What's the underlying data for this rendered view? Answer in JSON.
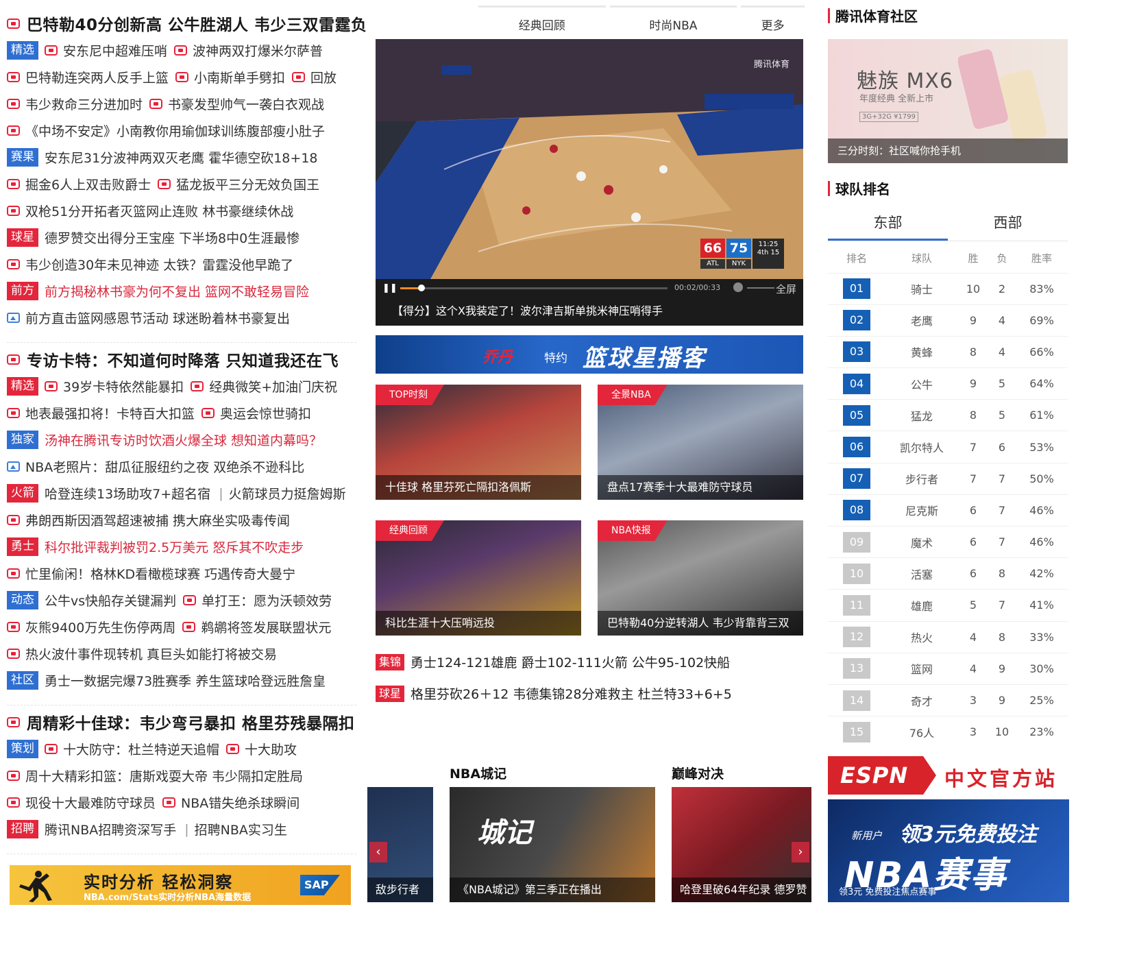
{
  "colors": {
    "accent_red": "#e3263b",
    "accent_blue": "#2f6fd1",
    "rank_top": "#1560b5",
    "rank_low": "#c9c9c9"
  },
  "left": {
    "sections": [
      {
        "title": "巴特勒40分创新高 公牛胜湖人 韦少三双雷霆负",
        "rows": [
          {
            "tag": "精选",
            "tag_color": "blue",
            "items": [
              "安东尼中超难压哨",
              "波神两双打爆米尔萨普"
            ]
          },
          {
            "items": [
              "巴特勒连突两人反手上篮",
              "小南斯单手劈扣",
              "回放"
            ]
          },
          {
            "items": [
              "韦少救命三分进加时",
              "书豪发型帅气一袭白衣观战"
            ]
          },
          {
            "items": [
              "《中场不安定》小南教你用瑜伽球训练腹部瘦小肚子"
            ]
          },
          {
            "tag": "赛果",
            "tag_color": "blue",
            "text": "安东尼31分波神两双灭老鹰 霍华德空砍18+18"
          },
          {
            "items": [
              "掘金6人上双击败爵士",
              "猛龙扳平三分无效负国王"
            ]
          },
          {
            "items": [
              "双枪51分开拓者灭篮网止连败 林书豪继续休战"
            ]
          },
          {
            "tag": "球星",
            "tag_color": "red",
            "text": "德罗赞交出得分王宝座 下半场8中0生涯最惨"
          },
          {
            "items": [
              "韦少创造30年未见神迹 太铁？雷霆没他早跪了"
            ]
          },
          {
            "tag": "前方",
            "tag_color": "red",
            "text": "前方揭秘林书豪为何不复出 篮网不敢轻易冒险",
            "red": true
          },
          {
            "picture": "前方直击篮网感恩节活动 球迷盼着林书豪复出"
          }
        ]
      },
      {
        "title": "专访卡特：不知道何时降落 只知道我还在飞",
        "rows": [
          {
            "tag": "精选",
            "tag_color": "red",
            "items": [
              "39岁卡特依然能暴扣",
              "经典微笑+加油门庆祝"
            ]
          },
          {
            "items": [
              "地表最强扣将！卡特百大扣篮",
              "奥运会惊世骑扣"
            ]
          },
          {
            "tag": "独家",
            "tag_color": "blue",
            "text": "汤神在腾讯专访时饮酒火爆全球 想知道内幕吗？",
            "red": true
          },
          {
            "picture": "NBA老照片：甜瓜征服纽约之夜 双绝杀不逊科比"
          },
          {
            "tag": "火箭",
            "tag_color": "red",
            "text": "哈登连续13场助攻7+超名宿",
            "text2": "火箭球员力挺詹姆斯"
          },
          {
            "items": [
              "弗朗西斯因酒驾超速被捕 携大麻坐实吸毒传闻"
            ]
          },
          {
            "tag": "勇士",
            "tag_color": "red",
            "text": "科尔批评裁判被罚2.5万美元 怒斥其不吹走步",
            "red": true
          },
          {
            "items": [
              "忙里偷闲！格林KD看橄榄球赛 巧遇传奇大曼宁"
            ]
          },
          {
            "tag": "动态",
            "tag_color": "blue",
            "text": "公牛vs快船存关键漏判",
            "items": [
              "单打王：愿为沃顿效劳"
            ]
          },
          {
            "items": [
              "灰熊9400万先生伤停两周",
              "鹈鹕将签发展联盟状元"
            ]
          },
          {
            "items": [
              "热火波什事件现转机 真巨头如能打将被交易"
            ]
          },
          {
            "tag": "社区",
            "tag_color": "blue",
            "text": "勇士一数据完爆73胜赛季 养生篮球哈登远胜詹皇"
          }
        ]
      },
      {
        "title": "周精彩十佳球：韦少弯弓暴扣 格里芬残暴隔扣",
        "rows": [
          {
            "tag": "策划",
            "tag_color": "blue",
            "items": [
              "十大防守：杜兰特逆天追帽",
              "十大助攻"
            ]
          },
          {
            "items": [
              "周十大精彩扣篮：唐斯戏耍大帝 韦少隔扣定胜局"
            ]
          },
          {
            "items": [
              "现役十大最难防守球员",
              "NBA错失绝杀球瞬间"
            ]
          },
          {
            "tag": "招聘",
            "tag_color": "red",
            "text": "腾讯NBA招聘资深写手",
            "text2": "招聘NBA实习生"
          }
        ]
      }
    ],
    "sap_ad": {
      "title": "实时分析  轻松洞察",
      "subtitle": "NBA.com/Stats实时分析NBA海量数据",
      "logo": "SAP"
    }
  },
  "mid": {
    "tabs": [
      "经典回顾",
      "时尚NBA",
      "更多"
    ],
    "player": {
      "watermark": "腾讯体育",
      "score_home": "66",
      "score_away": "75",
      "team_home": "ATL",
      "team_away": "NYK",
      "clock": "11:25",
      "quarter": "4th 15",
      "time": "00:02/00:33",
      "progress": 0.08,
      "fullscreen": "全屏",
      "caption": "【得分】这个X我装定了！波尔津吉斯单挑米神压哨得手"
    },
    "banner": {
      "brand": "乔丹",
      "sponsor": "特约",
      "title": "篮球星播客"
    },
    "cards": [
      {
        "label": "TOP时刻",
        "caption": "十佳球 格里芬死亡隔扣洛佩斯"
      },
      {
        "label": "全景NBA",
        "caption": "盘点17赛季十大最难防守球员"
      },
      {
        "label": "经典回顾",
        "caption": "科比生涯十大压哨远投"
      },
      {
        "label": "NBA快报",
        "caption": "巴特勒40分逆转湖人 韦少背靠背三双"
      }
    ],
    "headlines": [
      {
        "tag": "集锦",
        "text": "勇士124-121雄鹿 爵士102-111火箭 公牛95-102快船"
      },
      {
        "tag": "球星",
        "text": "格里芬砍26＋12 韦德集锦28分难救主 杜兰特33+6+5"
      }
    ],
    "bottom": {
      "left_caption": "敌步行者",
      "col1_title": "NBA城记",
      "col1_caption": "《NBA城记》第三季正在播出",
      "col1_logo": "城记",
      "col2_title": "巅峰对决",
      "col2_caption": "哈登里破64年纪录 德罗赞"
    }
  },
  "right": {
    "community_title": "腾讯体育社区",
    "phone_ad": {
      "brand": "魅族 MX6",
      "sub": "年度经典 全新上市",
      "price": "3G+32G ¥1799",
      "caption": "三分时刻：社区喊你抢手机"
    },
    "standings_title": "球队排名",
    "conferences": [
      "东部",
      "西部"
    ],
    "headers": [
      "排名",
      "球队",
      "胜",
      "负",
      "胜率"
    ],
    "rows": [
      [
        "01",
        "骑士",
        "10",
        "2",
        "83%"
      ],
      [
        "02",
        "老鹰",
        "9",
        "4",
        "69%"
      ],
      [
        "03",
        "黄蜂",
        "8",
        "4",
        "66%"
      ],
      [
        "04",
        "公牛",
        "9",
        "5",
        "64%"
      ],
      [
        "05",
        "猛龙",
        "8",
        "5",
        "61%"
      ],
      [
        "06",
        "凯尔特人",
        "7",
        "6",
        "53%"
      ],
      [
        "07",
        "步行者",
        "7",
        "7",
        "50%"
      ],
      [
        "08",
        "尼克斯",
        "6",
        "7",
        "46%"
      ],
      [
        "09",
        "魔术",
        "6",
        "7",
        "46%"
      ],
      [
        "10",
        "活塞",
        "6",
        "8",
        "42%"
      ],
      [
        "11",
        "雄鹿",
        "5",
        "7",
        "41%"
      ],
      [
        "12",
        "热火",
        "4",
        "8",
        "33%"
      ],
      [
        "13",
        "篮网",
        "4",
        "9",
        "30%"
      ],
      [
        "14",
        "奇才",
        "3",
        "9",
        "25%"
      ],
      [
        "15",
        "76人",
        "3",
        "10",
        "23%"
      ]
    ],
    "espn": {
      "logo": "ESPN",
      "text": "中文官方站"
    },
    "nba_ad": {
      "new_user": "新用户",
      "offer": "领3元免费投注",
      "big": "NBA赛事",
      "foot": "领3元 免费投注焦点赛事"
    }
  }
}
